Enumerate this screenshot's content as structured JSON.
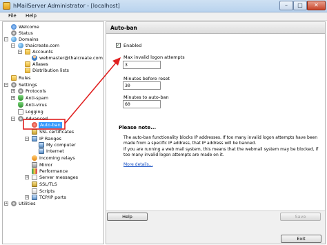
{
  "window": {
    "title": "hMailServer Administrator - [localhost]",
    "minimize_glyph": "–",
    "maximize_glyph": "□",
    "close_glyph": "✕"
  },
  "menu": {
    "file": "File",
    "help": "Help"
  },
  "tree": {
    "welcome": "Welcome",
    "status": "Status",
    "domains": "Domains",
    "domain": "thaicreate.com",
    "accounts": "Accounts",
    "account": "webmaster@thaicreate.com",
    "aliases": "Aliases",
    "distribution_lists": "Distribution lists",
    "rules": "Rules",
    "settings": "Settings",
    "protocols": "Protocols",
    "anti_spam": "Anti-spam",
    "anti_virus": "Anti-virus",
    "logging": "Logging",
    "advanced": "Advanced",
    "auto_ban": "Auto-ban",
    "ssl_certificates": "SSL certificates",
    "ip_ranges": "IP Ranges",
    "my_computer": "My computer",
    "internet": "Internet",
    "incoming_relays": "Incoming relays",
    "mirror": "Mirror",
    "performance": "Performance",
    "server_messages": "Server messages",
    "ssl_tls": "SSL/TLS",
    "scripts": "Scripts",
    "tcpip_ports": "TCP/IP ports",
    "utilities": "Utilities",
    "expanded_glyph": "−",
    "collapsed_glyph": "+"
  },
  "panel": {
    "title": "Auto-ban",
    "enabled_label": "Enabled",
    "enabled_checked_glyph": "✓",
    "max_attempts_label": "Max invalid logon attempts",
    "max_attempts_value": "3",
    "minutes_reset_label": "Minutes before reset",
    "minutes_reset_value": "30",
    "minutes_ban_label": "Minutes to auto-ban",
    "minutes_ban_value": "60",
    "note_title": "Please note...",
    "note_p1": "The auto-ban functionality blocks IP addresses. If too many invalid logon attempts have been made from a specific IP address, that IP address will be banned.",
    "note_p2": "If you are running a web mail system, this means that the webmail system may be blocked, if too many invalid logon attempts are made on it.",
    "more_details": "More details...",
    "help_button": "Help",
    "save_button": "Save",
    "exit_button": "Exit"
  },
  "colors": {
    "annotation": "#e02020",
    "selection": "#3399ff",
    "link": "#1a52c4"
  }
}
